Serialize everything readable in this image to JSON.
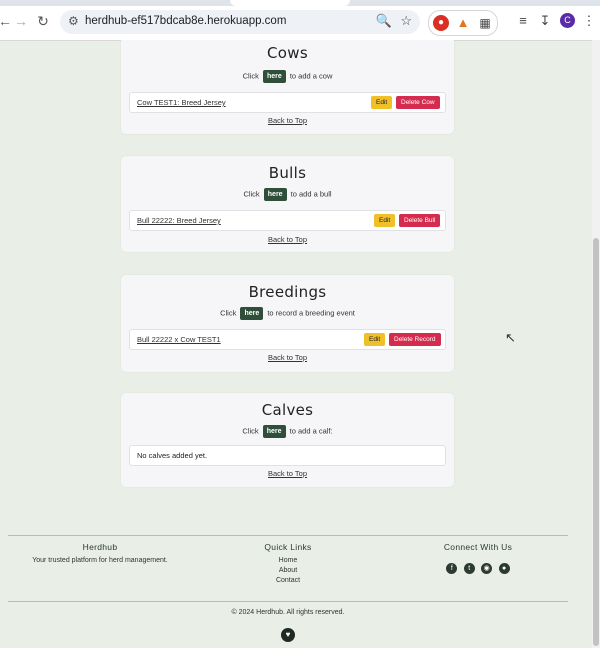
{
  "browser": {
    "url": "herdhub-ef517bdcab8e.herokuapp.com",
    "avatar_letter": "C"
  },
  "cows": {
    "title": "Cows",
    "click_prefix": "Click",
    "here_label": "here",
    "click_suffix": "to add a cow",
    "rows": [
      {
        "label": "Cow TEST1: Breed Jersey",
        "edit": "Edit",
        "delete": "Delete Cow"
      }
    ],
    "back_to_top": "Back to Top"
  },
  "bulls": {
    "title": "Bulls",
    "click_prefix": "Click",
    "here_label": "here",
    "click_suffix": "to add a bull",
    "rows": [
      {
        "label": "Bull 22222: Breed Jersey",
        "edit": "Edit",
        "delete": "Delete Bull"
      }
    ],
    "back_to_top": "Back to Top"
  },
  "breedings": {
    "title": "Breedings",
    "click_prefix": "Click",
    "here_label": "here",
    "click_suffix": "to record a breeding event",
    "rows": [
      {
        "label": "Bull 22222 x Cow TEST1",
        "edit": "Edit",
        "delete": "Delete Record"
      }
    ],
    "back_to_top": "Back to Top"
  },
  "calves": {
    "title": "Calves",
    "click_prefix": "Click",
    "here_label": "here",
    "click_suffix": "to add a calf:",
    "empty_message": "No calves added yet.",
    "back_to_top": "Back to Top"
  },
  "footer": {
    "brand_title": "Herdhub",
    "brand_tagline": "Your trusted platform for herd management.",
    "links_title": "Quick Links",
    "links": [
      "Home",
      "About",
      "Contact"
    ],
    "connect_title": "Connect With Us",
    "social_icons": [
      "facebook-icon",
      "twitter-icon",
      "instagram-icon",
      "github-icon"
    ],
    "copyright": "© 2024 Herdhub. All rights reserved."
  },
  "colors": {
    "page_bg": "#e9eee6",
    "here_button": "#2f4f3a",
    "edit_button": "#f0c02a",
    "delete_button": "#d52b4f"
  }
}
